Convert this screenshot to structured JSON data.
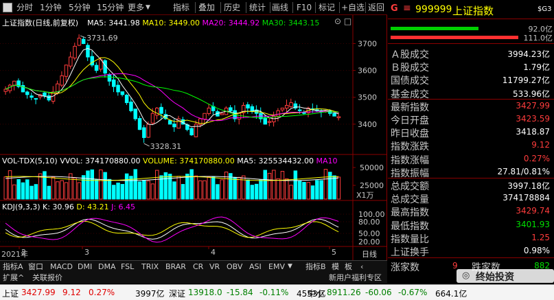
{
  "toolbar": {
    "left_items": [
      "分时",
      "1分钟",
      "5分钟",
      "15分钟",
      "更多"
    ],
    "right_items": [
      "指标",
      "叠加",
      "历史",
      "统计",
      "画线",
      "F10",
      "标记",
      "+自选",
      "返回"
    ]
  },
  "header": {
    "market_icon": "G",
    "menu_icon": "≡",
    "code": "999999",
    "name": "上证指数",
    "suffix": "$G3"
  },
  "main_chart": {
    "title": "上证指数(日线,前复权)",
    "ma_labels": [
      "MA5: 3441.98",
      "MA10: 3449.00",
      "MA20: 3444.92",
      "MA30: 3443.15"
    ],
    "high_label": "3731.69",
    "low_label": "3328.31",
    "y_ticks": [
      "3700",
      "3600",
      "3500",
      "3400"
    ]
  },
  "vol_chart": {
    "title": "VOL-TDX(5,10)",
    "vvol": "VVOL: 374170880.00",
    "volume": "VOLUME: 374170880.00",
    "ma5": "MA5: 325534432.00",
    "ma10": "MA10",
    "y_ticks": [
      "50000",
      "25000"
    ],
    "unit": "X1万"
  },
  "kdj_chart": {
    "title": "KDJ(9,3,3)",
    "k": "K: 30.96",
    "d": "D: 43.21",
    "j": "J: 6.45",
    "y_ticks": [
      "100.00",
      "80.00",
      "50.00",
      "20.00"
    ]
  },
  "x_axis": {
    "year_label": "2021年",
    "month_labels": [
      "2",
      "3",
      "4",
      "5"
    ],
    "period": "日线"
  },
  "indicator_tabs": [
    "指标A",
    "窗口",
    "MACD",
    "DMI",
    "DMA",
    "FSL",
    "TRIX",
    "BRAR",
    "CR",
    "VR",
    "OBV",
    "ASI",
    "EMV",
    "指标B",
    "模",
    "板"
  ],
  "ext_tabs": {
    "left": [
      "扩展^",
      "关联报价"
    ],
    "right": [
      "新用户福利专区",
      "笔"
    ]
  },
  "info": {
    "bar_values": [
      "92.0亿",
      "111.0亿"
    ],
    "rows": [
      {
        "label": "Ａ股成交",
        "value": "3994.23亿",
        "color": "white"
      },
      {
        "label": "Ｂ股成交",
        "value": "1.79亿",
        "color": "white"
      },
      {
        "label": "国债成交",
        "value": "11799.27亿",
        "color": "white"
      },
      {
        "label": "基金成交",
        "value": "533.96亿",
        "color": "white"
      },
      {
        "label": "最新指数",
        "value": "3427.99",
        "color": "red"
      },
      {
        "label": "今日开盘",
        "value": "3423.59",
        "color": "red"
      },
      {
        "label": "昨日收盘",
        "value": "3418.87",
        "color": "white"
      },
      {
        "label": "指数涨跌",
        "value": "9.12",
        "color": "red"
      },
      {
        "label": "指数涨幅",
        "value": "0.27%",
        "color": "red"
      },
      {
        "label": "指数振幅",
        "value": "27.81/0.81%",
        "color": "white"
      },
      {
        "label": "总成交额",
        "value": "3997.18亿",
        "color": "white"
      },
      {
        "label": "总成交量",
        "value": "374178884",
        "color": "white"
      },
      {
        "label": "最高指数",
        "value": "3429.74",
        "color": "red"
      },
      {
        "label": "最低指数",
        "value": "3401.93",
        "color": "green"
      },
      {
        "label": "指数量比",
        "value": "1.25",
        "color": "red"
      },
      {
        "label": "上证换手",
        "value": "0.98%",
        "color": "white"
      }
    ],
    "updown": {
      "up_label": "涨家数",
      "up_value": "9",
      "down_label": "跌家数",
      "down_value": "882"
    },
    "watermark": "终始投资"
  },
  "status_bar": {
    "items": [
      {
        "name": "上证",
        "price": "3427.99",
        "change": "9.12",
        "pct": "0.27%",
        "amount": "3997亿",
        "dir": "up"
      },
      {
        "name": "深证",
        "price": "13918.0",
        "change": "-15.84",
        "pct": "-0.11%",
        "amount": "4553亿",
        "dir": "down"
      },
      {
        "name": "中小",
        "price": "8911.26",
        "change": "-60.06",
        "pct": "-0.67%",
        "amount": "664.1亿",
        "dir": "down"
      }
    ]
  },
  "colors": {
    "up": "#ff3c3c",
    "down": "#00ffff",
    "ma5": "#ffffff",
    "ma10": "#ffff00",
    "ma20": "#ff00ff",
    "ma30": "#00ff00",
    "panel_border": "#8b0000"
  }
}
